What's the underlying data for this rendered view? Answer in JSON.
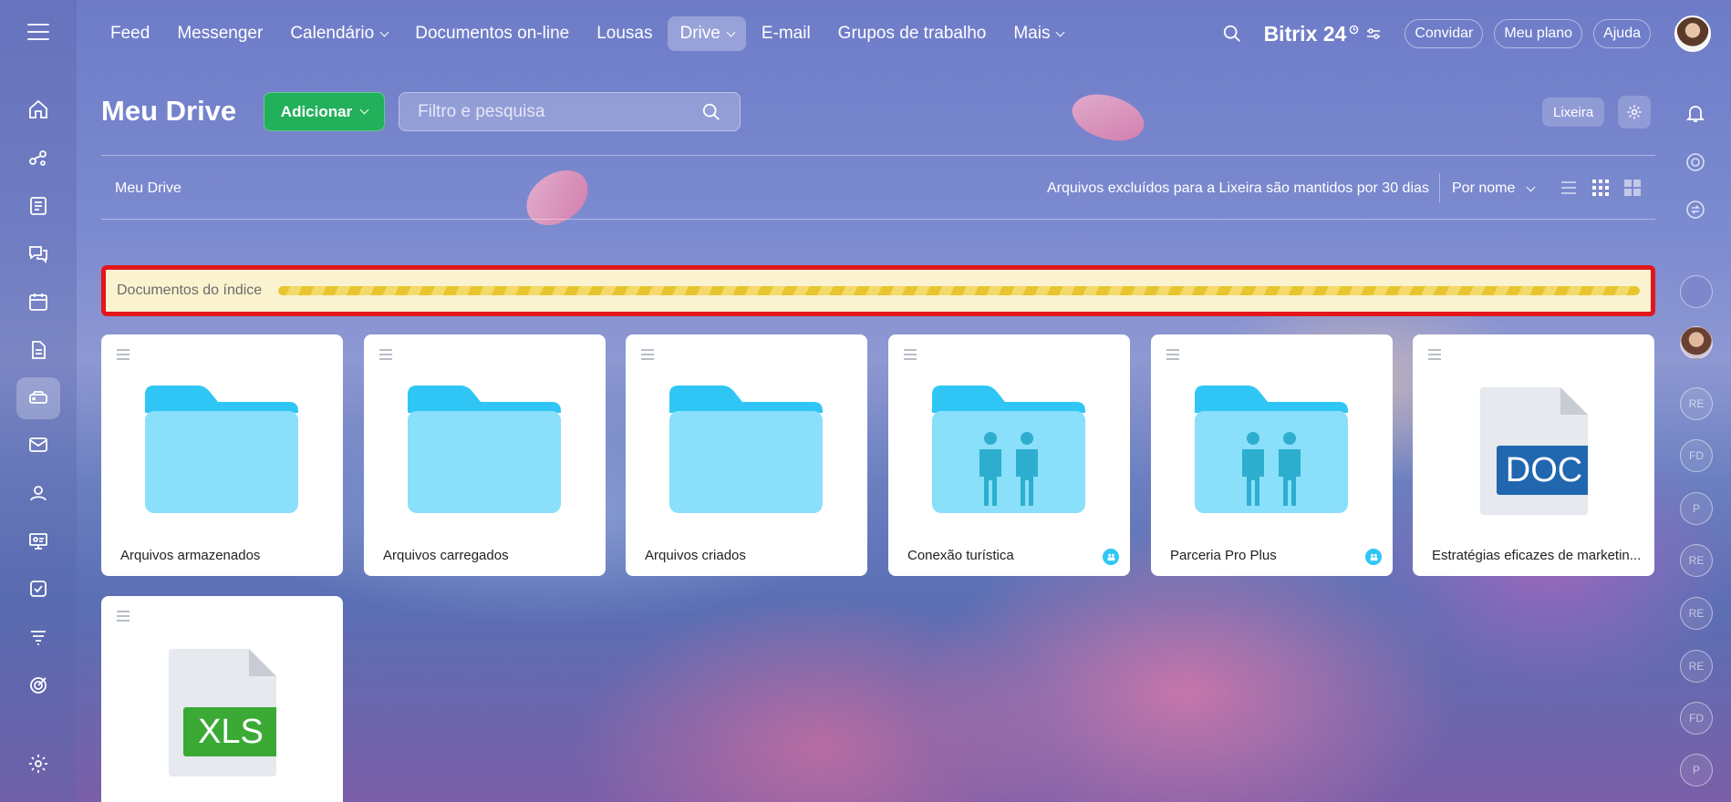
{
  "nav": {
    "items": [
      {
        "label": "Feed",
        "has_menu": false,
        "active": false
      },
      {
        "label": "Messenger",
        "has_menu": false,
        "active": false
      },
      {
        "label": "Calendário",
        "has_menu": true,
        "active": false
      },
      {
        "label": "Documentos on-line",
        "has_menu": false,
        "active": false
      },
      {
        "label": "Lousas",
        "has_menu": false,
        "active": false
      },
      {
        "label": "Drive",
        "has_menu": true,
        "active": true
      },
      {
        "label": "E-mail",
        "has_menu": false,
        "active": false
      },
      {
        "label": "Grupos de trabalho",
        "has_menu": false,
        "active": false
      },
      {
        "label": "Mais",
        "has_menu": true,
        "active": false
      }
    ],
    "brand": "Bitrix 24",
    "invite_label": "Convidar",
    "plan_label": "Meu plano",
    "help_label": "Ajuda"
  },
  "sidebar": {
    "icons": [
      "home-icon",
      "automation-icon",
      "news-icon",
      "chat-icon",
      "calendar-icon",
      "document-icon",
      "drive-icon",
      "mail-icon",
      "contacts-icon",
      "presentation-icon",
      "tasks-icon",
      "filter-icon",
      "target-icon",
      "settings-icon"
    ],
    "active": "drive-icon"
  },
  "right_rail": {
    "icons": [
      "bell-icon",
      "copilot-icon",
      "sync-icon"
    ],
    "avatars": [
      "",
      "",
      "RE",
      "FD",
      "P",
      "RE",
      "RE",
      "RE",
      "FD",
      "P"
    ]
  },
  "header": {
    "title": "Meu Drive",
    "add_label": "Adicionar",
    "search_placeholder": "Filtro e pesquisa",
    "trash_label": "Lixeira"
  },
  "toolbar": {
    "breadcrumb": "Meu Drive",
    "retention_note": "Arquivos excluídos para a Lixeira são mantidos por 30 dias",
    "sort_label": "Por nome"
  },
  "index": {
    "label": "Documentos do índice"
  },
  "files": [
    {
      "name": "Arquivos armazenados",
      "type": "folder",
      "shared": false
    },
    {
      "name": "Arquivos carregados",
      "type": "folder",
      "shared": false
    },
    {
      "name": "Arquivos criados",
      "type": "folder",
      "shared": false
    },
    {
      "name": "Conexão turística",
      "type": "shared-folder",
      "shared": true
    },
    {
      "name": "Parceria Pro Plus",
      "type": "shared-folder",
      "shared": true
    },
    {
      "name": "Estratégias eficazes de marketin...",
      "type": "doc",
      "badge": "DOC",
      "shared": false
    },
    {
      "name": "",
      "type": "xls",
      "badge": "XLS",
      "shared": false
    }
  ],
  "colors": {
    "add_button": "#22b05a",
    "folder_body": "#8adffb",
    "folder_tab": "#2fc6f6",
    "doc_badge": "#2067b0",
    "xls_badge": "#3aaa35",
    "highlight": "#e3161c",
    "progress": "#e8c52e"
  }
}
